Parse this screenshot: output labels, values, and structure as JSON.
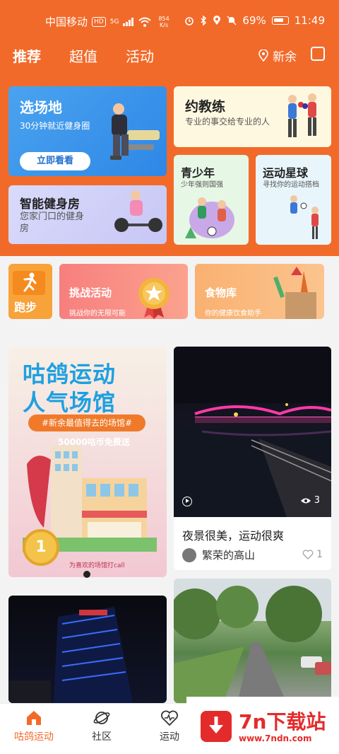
{
  "status": {
    "carrier": "中国移动",
    "hd": "HD",
    "signal": "5G",
    "speed_value": "854",
    "speed_unit": "K/s",
    "battery": "69%",
    "time": "11:49"
  },
  "header": {
    "tabs": [
      "推荐",
      "超值",
      "活动"
    ],
    "location": "新余"
  },
  "hero": {
    "venue": {
      "title": "选场地",
      "subtitle": "30分钟就近健身圈",
      "button": "立即看看"
    },
    "gym": {
      "title": "智能健身房",
      "subtitle": "您家门口的健身房"
    },
    "coach": {
      "title": "约教练",
      "subtitle": "专业的事交给专业的人"
    },
    "youth": {
      "title": "青少年",
      "subtitle": "少年强则国强"
    },
    "star": {
      "title": "运动星球",
      "subtitle": "寻找你的运动搭档"
    }
  },
  "shortcuts": {
    "run": {
      "title": "跑步"
    },
    "challenge": {
      "title": "挑战活动",
      "subtitle": "挑战你的无限可能"
    },
    "food": {
      "title": "食物库",
      "subtitle": "你的健康饮食助手"
    }
  },
  "banner": {
    "line1": "咕鸽运动",
    "line2": "人气场馆",
    "pill": "#新余最值得去的场馆#",
    "promo": "50000咕币免费送",
    "footer": "为喜欢的场馆打call",
    "medal": "1"
  },
  "posts": [
    {
      "text": "夜景很美，运动很爽",
      "author": "繁荣的高山",
      "likes": "1",
      "views": "3"
    }
  ],
  "bottom_nav": [
    "咕鸽运动",
    "社区",
    "运动"
  ],
  "watermark": {
    "title": "7n下载站",
    "url": "www.7ndn.com"
  },
  "colors": {
    "brand": "#f26a2a",
    "venue_blue": "#2e87e6",
    "watermark_red": "#e42b2b"
  },
  "icons": {
    "location": "location-pin-icon",
    "calendar": "calendar-icon",
    "run": "runner-icon",
    "video": "play-icon",
    "views": "eye-icon",
    "like": "heart-icon",
    "home": "home-icon",
    "community": "planet-icon",
    "sport": "heartbeat-icon"
  }
}
